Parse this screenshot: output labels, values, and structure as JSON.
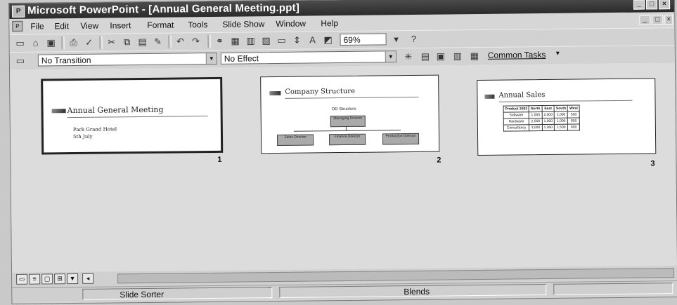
{
  "window": {
    "title": "Microsoft PowerPoint - [Annual General Meeting.ppt]",
    "app_icon": "powerpoint-icon",
    "controls": [
      "minimize",
      "restore",
      "close"
    ]
  },
  "menu": {
    "items": [
      "File",
      "Edit",
      "View",
      "Insert",
      "Format",
      "Tools",
      "Slide Show",
      "Window",
      "Help"
    ]
  },
  "toolbar": {
    "zoom": "69%",
    "icons": [
      "new-icon",
      "open-icon",
      "save-icon",
      "print-icon",
      "spelling-icon",
      "cut-icon",
      "copy-icon",
      "paste-icon",
      "format-painter-icon",
      "undo-icon",
      "redo-icon",
      "hyperlink-icon",
      "tables-borders-icon",
      "insert-table-icon",
      "insert-chart-icon",
      "new-slide-icon",
      "expand-all-icon",
      "show-formatting-icon",
      "grayscale-icon",
      "zoom-box",
      "help-icon"
    ]
  },
  "sorter_toolbar": {
    "transition": "No Transition",
    "effect": "No Effect",
    "common_tasks": "Common Tasks"
  },
  "slides": [
    {
      "number": "1",
      "title": "Annual General Meeting",
      "lines": [
        "Park Grand Hotel",
        "5th July"
      ]
    },
    {
      "number": "2",
      "title": "Company Structure",
      "chart_title": "OD Structure",
      "top_box": "Managing Director",
      "boxes": [
        "Sales Director",
        "Finance Director",
        "Production Director"
      ]
    },
    {
      "number": "3",
      "title": "Annual Sales",
      "table": [
        [
          "Product 2002",
          "North",
          "East",
          "South",
          "West"
        ],
        [
          "Software",
          "1,000",
          "2,000",
          "1,000",
          "500"
        ],
        [
          "Hardware",
          "2,000",
          "1,000",
          "1,000",
          "800"
        ],
        [
          "Consultancy",
          "3,000",
          "1,000",
          "1,500",
          "600"
        ]
      ]
    }
  ],
  "status": {
    "view": "Slide Sorter",
    "design": "Blends"
  }
}
